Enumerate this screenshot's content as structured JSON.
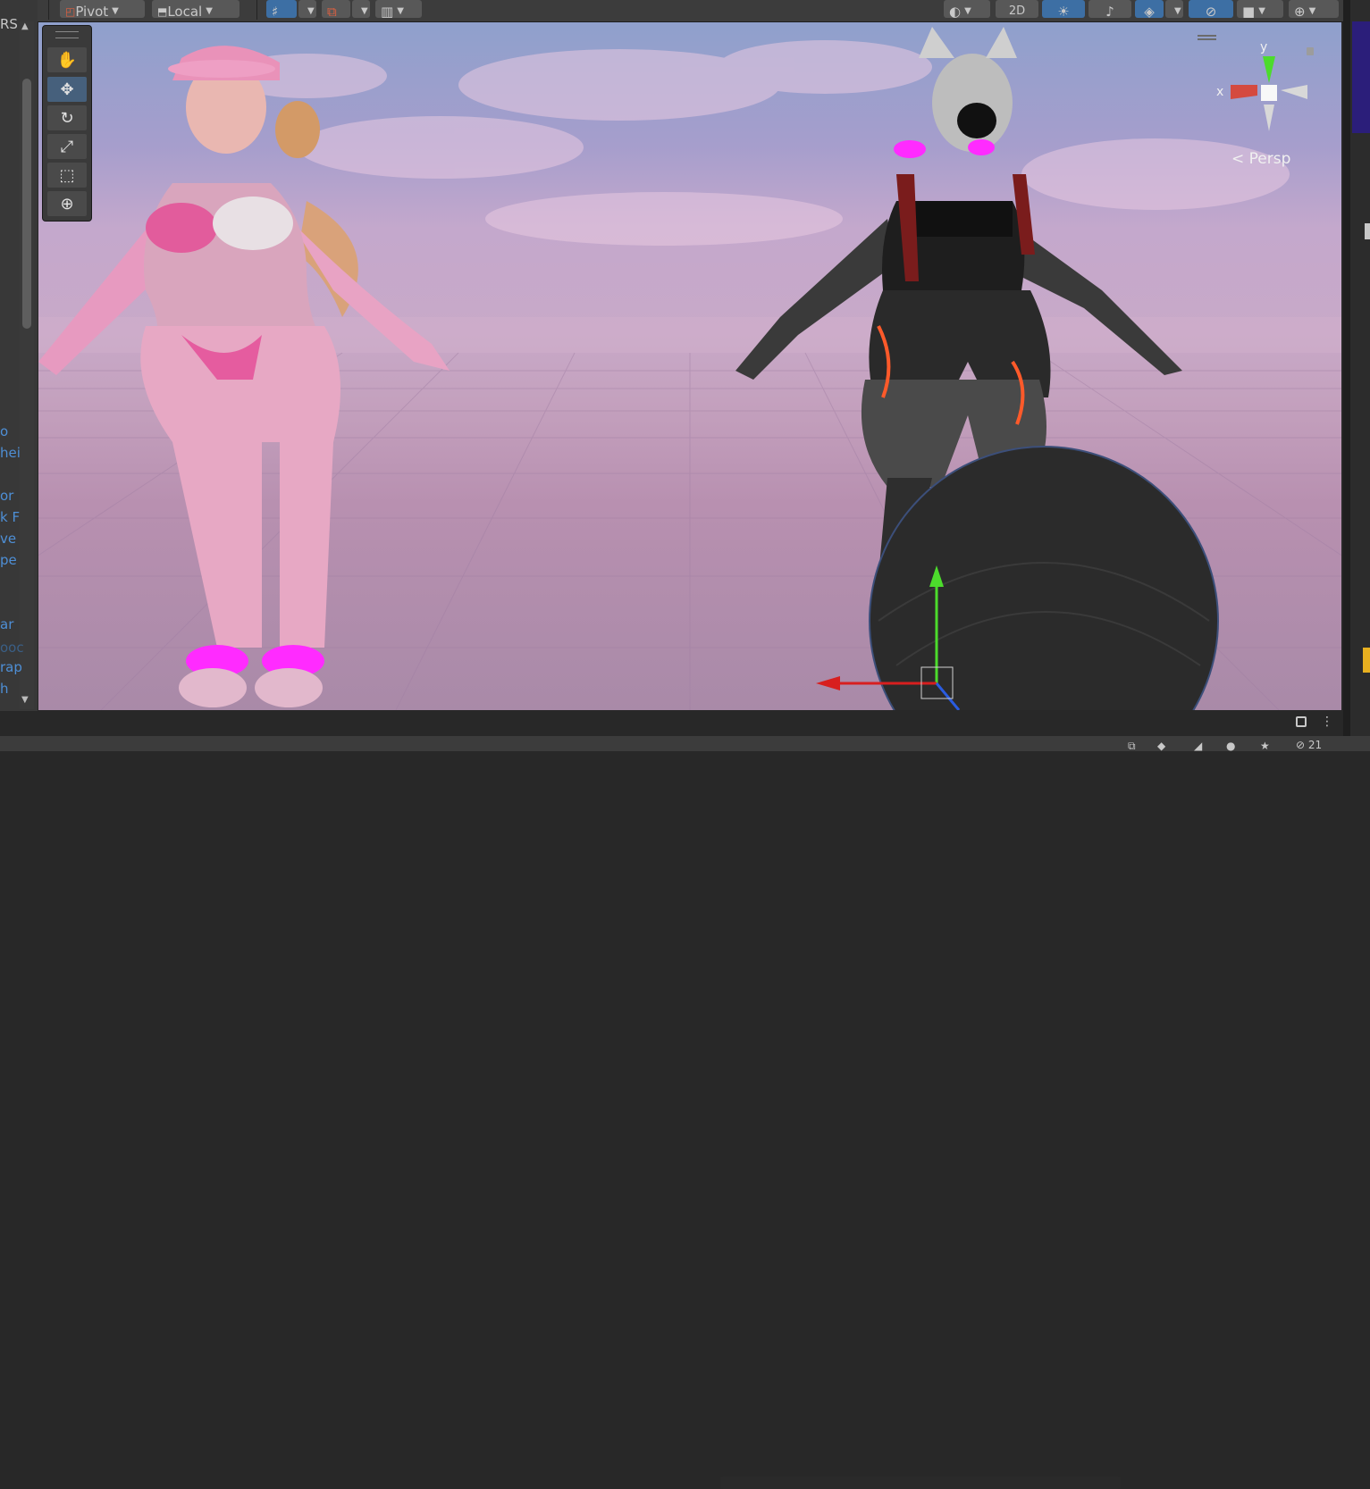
{
  "toolbar": {
    "pivot_label": "Pivot",
    "local_label": "Local",
    "mode_2d_label": "2D",
    "icon_names": [
      "pivot-icon",
      "local-icon",
      "snap-icon",
      "grid-icon",
      "rect-snap-icon",
      "shading-icon",
      "lighting-icon",
      "audio-icon",
      "effects-icon",
      "hidden-icon",
      "camera-icon",
      "gizmos-icon"
    ]
  },
  "left_panel": {
    "header_fragment": "RS",
    "texts": [
      "o",
      "hei",
      "or",
      "k F",
      "ve",
      "pe",
      "ar",
      "ooc",
      "rap",
      "h"
    ]
  },
  "tools": {
    "items": [
      {
        "name": "hand-tool",
        "glyph": "✋",
        "active": false
      },
      {
        "name": "move-tool",
        "glyph": "✥",
        "active": true
      },
      {
        "name": "rotate-tool",
        "glyph": "↻",
        "active": false
      },
      {
        "name": "scale-tool",
        "glyph": "⤢",
        "active": false
      },
      {
        "name": "rect-tool",
        "glyph": "⬚",
        "active": false
      },
      {
        "name": "transform-tool",
        "glyph": "⊕",
        "active": false
      }
    ]
  },
  "gizmo": {
    "x_label": "x",
    "y_label": "y",
    "persp_label": "Persp"
  },
  "colors": {
    "toolbar_bg": "#3c3c3c",
    "active_blue": "#3d6fa4",
    "sky_top": "#8fa0cc",
    "sky_bottom": "#a98aa8",
    "axis_x": "#d81f1f",
    "axis_y": "#4cdc2c",
    "axis_z": "#2a5ce0"
  },
  "status_bar": {
    "count_label": "21"
  }
}
